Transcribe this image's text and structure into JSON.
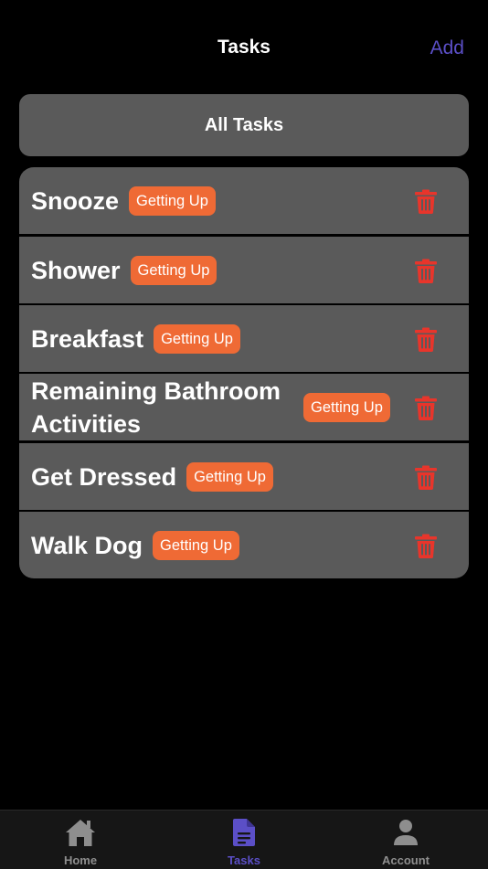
{
  "nav": {
    "title": "Tasks",
    "add_label": "Add"
  },
  "filter": {
    "label": "All Tasks"
  },
  "tasks": [
    {
      "name": "Snooze",
      "category": "Getting Up"
    },
    {
      "name": "Shower",
      "category": "Getting Up"
    },
    {
      "name": "Breakfast",
      "category": "Getting Up"
    },
    {
      "name": "Remaining Bathroom Activities",
      "category": "Getting Up"
    },
    {
      "name": "Get Dressed",
      "category": "Getting Up"
    },
    {
      "name": "Walk Dog",
      "category": "Getting Up"
    }
  ],
  "tabbar": {
    "items": [
      {
        "label": "Home",
        "icon": "house-icon"
      },
      {
        "label": "Tasks",
        "icon": "document-icon",
        "active": true
      },
      {
        "label": "Account",
        "icon": "person-icon"
      }
    ]
  },
  "colors": {
    "accent": "#5b4fc7",
    "badge": "#ef6a35",
    "delete": "#e8352b",
    "row_background": "#5a5a5a",
    "background": "#000000"
  }
}
